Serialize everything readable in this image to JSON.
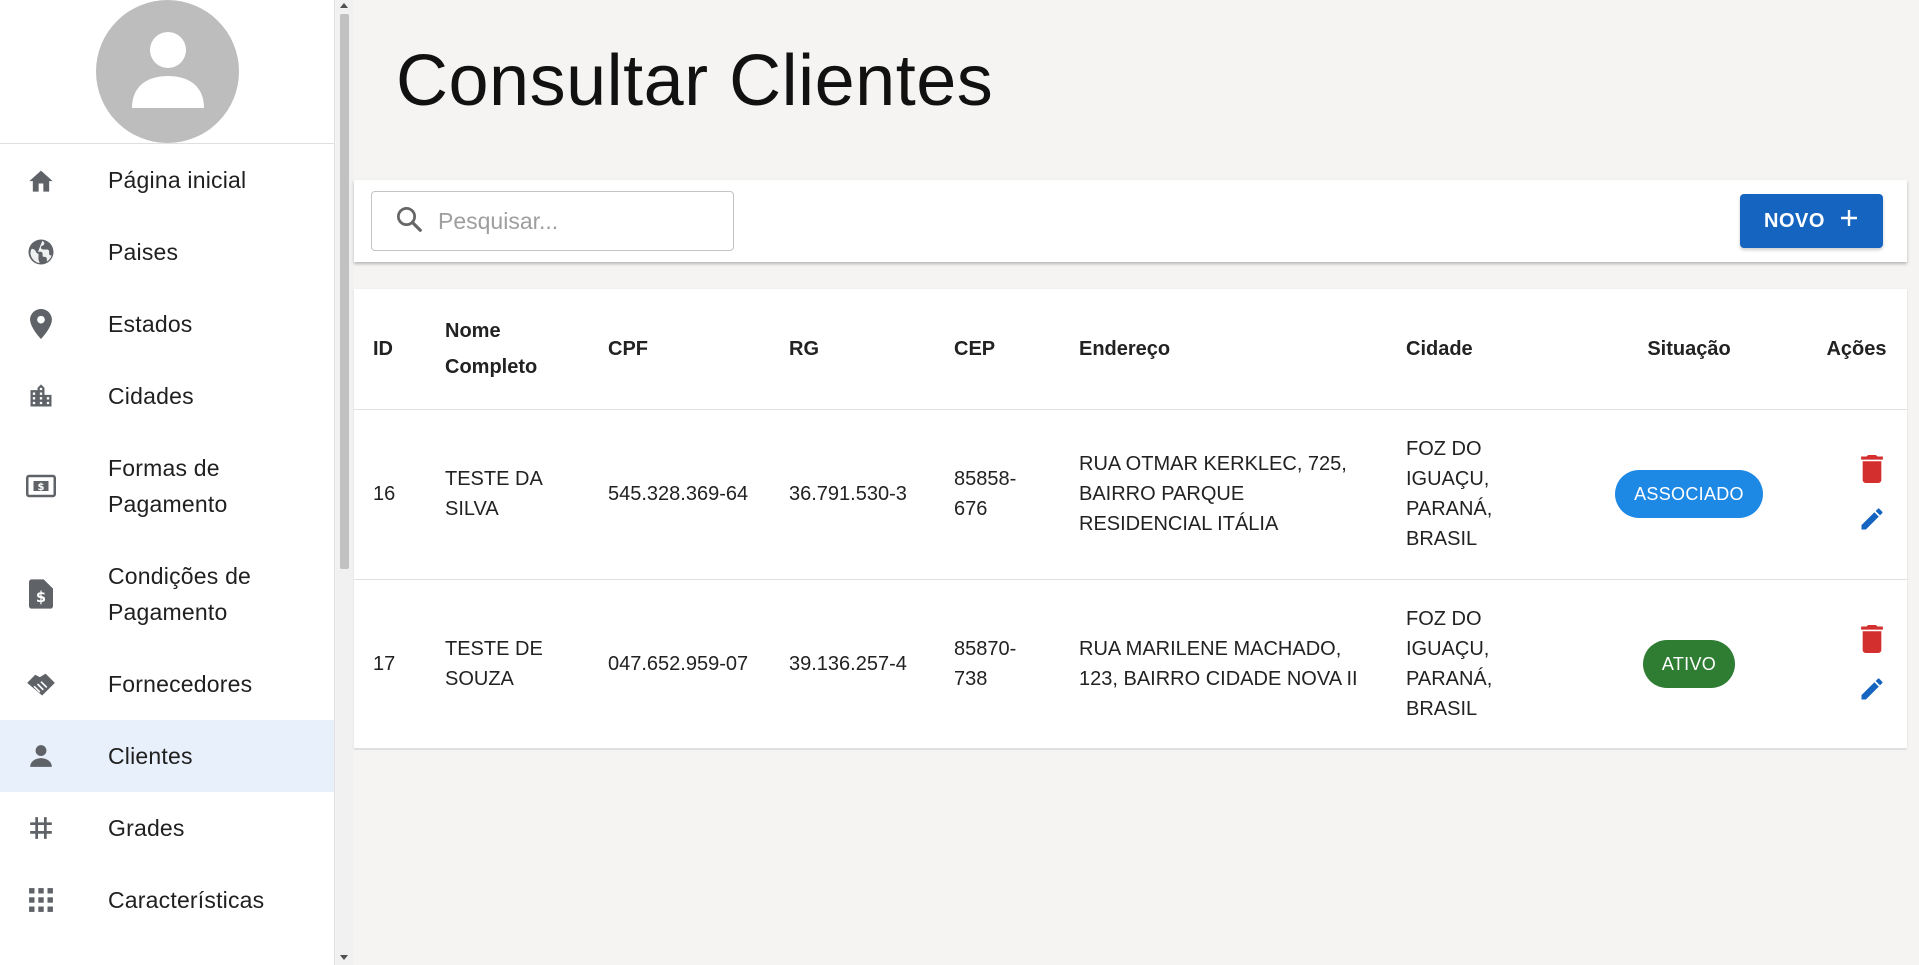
{
  "sidebar": {
    "items": [
      {
        "label": "Página inicial",
        "icon": "home-icon"
      },
      {
        "label": "Paises",
        "icon": "globe-icon"
      },
      {
        "label": "Estados",
        "icon": "location-pin-icon"
      },
      {
        "label": "Cidades",
        "icon": "city-icon"
      },
      {
        "label": "Formas de Pagamento",
        "icon": "money-icon"
      },
      {
        "label": "Condições de Pagamento",
        "icon": "invoice-icon"
      },
      {
        "label": "Fornecedores",
        "icon": "handshake-icon"
      },
      {
        "label": "Clientes",
        "icon": "person-icon",
        "active": true
      },
      {
        "label": "Grades",
        "icon": "hash-icon"
      },
      {
        "label": "Características",
        "icon": "apps-grid-icon"
      }
    ]
  },
  "page": {
    "title": "Consultar Clientes"
  },
  "toolbar": {
    "search_placeholder": "Pesquisar...",
    "novo_label": "NOVO"
  },
  "table": {
    "headers": {
      "id": "ID",
      "nome": "Nome Completo",
      "cpf": "CPF",
      "rg": "RG",
      "cep": "CEP",
      "endereco": "Endereço",
      "cidade": "Cidade",
      "situacao": "Situação",
      "acoes": "Ações"
    },
    "rows": [
      {
        "id": "16",
        "nome": "TESTE DA SILVA",
        "cpf": "545.328.369-64",
        "rg": "36.791.530-3",
        "cep": "85858-676",
        "endereco": "RUA OTMAR KERKLEC, 725, BAIRRO PARQUE RESIDENCIAL ITÁLIA",
        "cidade": "FOZ DO IGUAÇU, PARANÁ, BRASIL",
        "situacao": "ASSOCIADO"
      },
      {
        "id": "17",
        "nome": "TESTE DE SOUZA",
        "cpf": "047.652.959-07",
        "rg": "39.136.257-4",
        "cep": "85870-738",
        "endereco": "RUA MARILENE MACHADO, 123, BAIRRO CIDADE NOVA II",
        "cidade": "FOZ DO IGUAÇU, PARANÁ, BRASIL",
        "situacao": "ATIVO"
      }
    ]
  },
  "colors": {
    "primary": "#1565c0",
    "associado": "#1e88e5",
    "ativo": "#2e7d32",
    "delete": "#d32f2f",
    "edit": "#1565c0",
    "active_nav_bg": "#e8f0fb"
  }
}
